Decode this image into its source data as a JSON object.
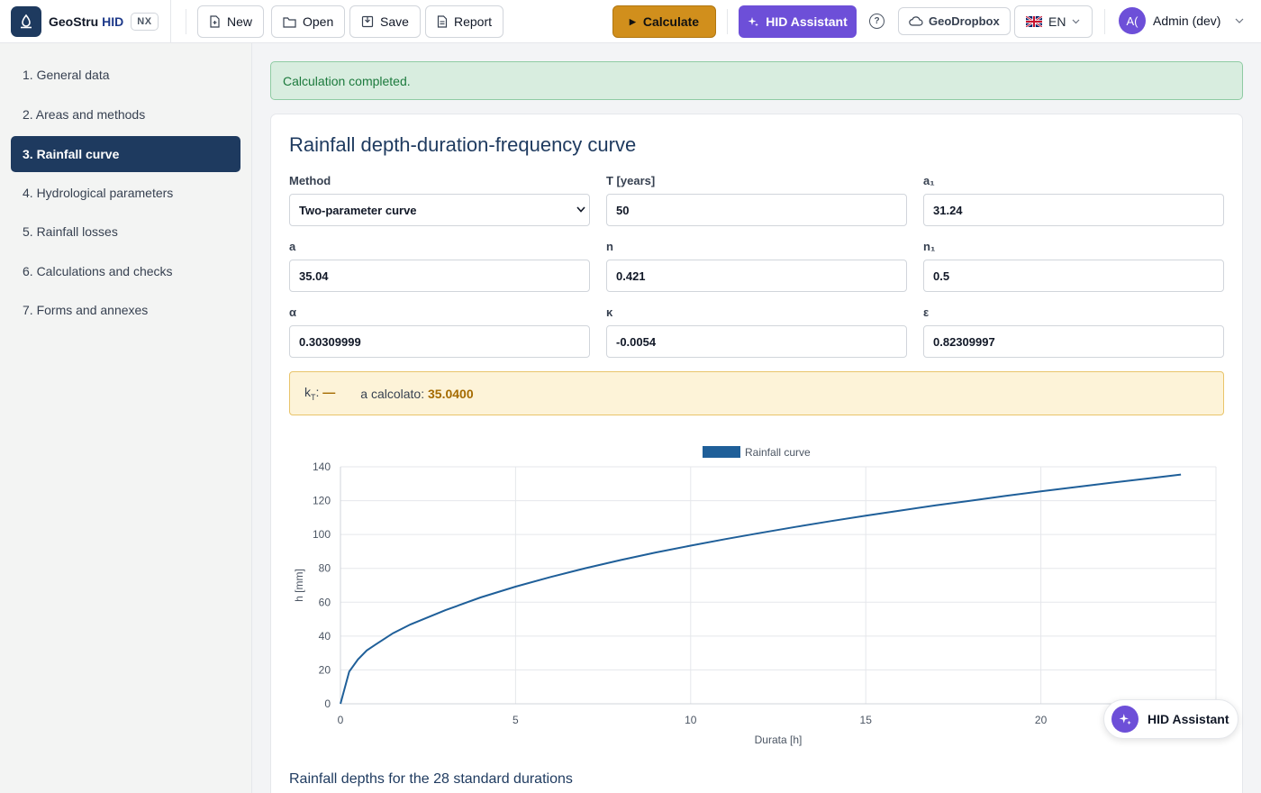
{
  "app": {
    "brand_prefix": "GeoStru",
    "brand_suffix": "HID",
    "badge": "NX"
  },
  "toolbar": {
    "new_label": "New",
    "open_label": "Open",
    "save_label": "Save",
    "report_label": "Report",
    "calculate_label": "Calculate",
    "assistant_label": "HID Assistant",
    "help_glyph": "?",
    "dropbox_label": "GeoDropbox",
    "language": "EN",
    "user_initials": "A(",
    "user_name": "Admin (dev)"
  },
  "sidebar": {
    "items": [
      {
        "label": "1. General data",
        "active": false
      },
      {
        "label": "2. Areas and methods",
        "active": false
      },
      {
        "label": "3. Rainfall curve",
        "active": true
      },
      {
        "label": "4. Hydrological parameters",
        "active": false
      },
      {
        "label": "5. Rainfall losses",
        "active": false
      },
      {
        "label": "6. Calculations and checks",
        "active": false
      },
      {
        "label": "7. Forms and annexes",
        "active": false
      }
    ]
  },
  "alert": {
    "message": "Calculation completed."
  },
  "form": {
    "title": "Rainfall depth-duration-frequency curve",
    "method_label": "Method",
    "method_value": "Two-parameter curve",
    "t_label": "T [years]",
    "t_value": "50",
    "a1_label": "a₁",
    "a1_value": "31.24",
    "a_label": "a",
    "a_value": "35.04",
    "n_label": "n",
    "n_value": "0.421",
    "n1_label": "n₁",
    "n1_value": "0.5",
    "alpha_label": "α",
    "alpha_value": "0.30309999",
    "kappa_label": "κ",
    "kappa_value": "-0.0054",
    "eps_label": "ε",
    "eps_value": "0.82309997"
  },
  "info": {
    "kt_label": "k",
    "kt_sub": "T",
    "kt_value": "—",
    "a_calc_label": "a calcolato:",
    "a_calc_value": "35.0400"
  },
  "chart_data": {
    "type": "line",
    "title": "",
    "legend": "top-center",
    "series": [
      {
        "name": "Rainfall curve",
        "color": "#1f5f99",
        "x": [
          0,
          0.25,
          0.5,
          0.75,
          1,
          1.5,
          2,
          3,
          4,
          5,
          6,
          7,
          8,
          9,
          10,
          11,
          12,
          13,
          14,
          15,
          16,
          17,
          18,
          19,
          20,
          21,
          22,
          23,
          24
        ],
        "y": [
          0,
          19.0,
          26.2,
          31.5,
          35.0,
          41.7,
          46.9,
          55.3,
          62.8,
          69.2,
          74.9,
          80.1,
          84.9,
          89.4,
          93.4,
          97.3,
          101.0,
          104.5,
          107.9,
          111.1,
          114.2,
          117.2,
          120.0,
          122.8,
          125.5,
          128.0,
          130.6,
          133.0,
          135.4
        ]
      }
    ],
    "xlabel": "Durata [h]",
    "ylabel": "h [mm]",
    "xlim": [
      0,
      25
    ],
    "ylim": [
      0,
      140
    ],
    "xticks": [
      0,
      5,
      10,
      15,
      20
    ],
    "yticks": [
      0,
      20,
      40,
      60,
      80,
      100,
      120,
      140
    ],
    "grid": true
  },
  "table": {
    "title": "Rainfall depths for the 28 standard durations"
  },
  "floating": {
    "label": "HID Assistant"
  }
}
